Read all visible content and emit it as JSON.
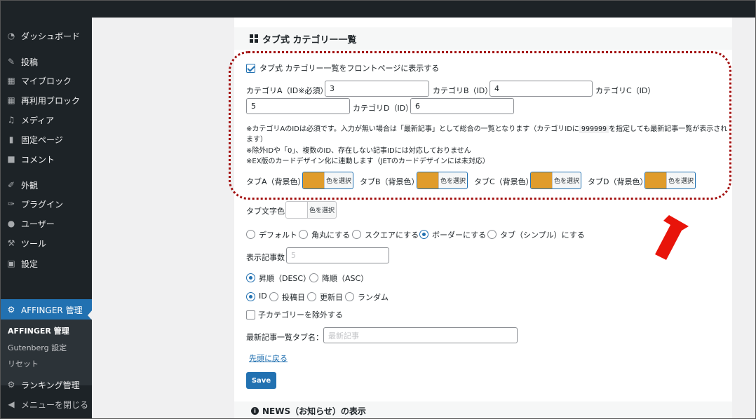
{
  "sidebar": {
    "items": [
      {
        "label": "ダッシュボード",
        "icon": "dashboard-icon"
      },
      {
        "label": "投稿",
        "icon": "pin-icon"
      },
      {
        "label": "マイブロック",
        "icon": "grid-icon"
      },
      {
        "label": "再利用ブロック",
        "icon": "grid-icon"
      },
      {
        "label": "メディア",
        "icon": "media-icon"
      },
      {
        "label": "固定ページ",
        "icon": "page-icon"
      },
      {
        "label": "コメント",
        "icon": "comment-icon"
      },
      {
        "label": "外観",
        "icon": "brush-icon"
      },
      {
        "label": "プラグイン",
        "icon": "plugin-icon"
      },
      {
        "label": "ユーザー",
        "icon": "user-icon"
      },
      {
        "label": "ツール",
        "icon": "wrench-icon"
      },
      {
        "label": "設定",
        "icon": "settings-icon"
      }
    ],
    "active_item": {
      "label": "AFFINGER 管理",
      "icon": "gear-icon"
    },
    "submenu": [
      {
        "label": "AFFINGER 管理",
        "current": true
      },
      {
        "label": "Gutenberg 設定",
        "current": false
      },
      {
        "label": "リセット",
        "current": false
      }
    ],
    "ranking": {
      "label": "ランキング管理",
      "icon": "gear-icon"
    },
    "collapse": {
      "label": "メニューを閉じる",
      "icon": "collapse-icon"
    }
  },
  "panel": {
    "title": "タブ式 カテゴリー一覧",
    "show_on_front": {
      "label": "タブ式 カテゴリー一覧をフロントページに表示する",
      "checked": true
    },
    "categories": {
      "a_label": "カテゴリA（ID※必須）",
      "a_value": "3",
      "b_label": "カテゴリB（ID）",
      "b_value": "4",
      "c_label": "カテゴリC（ID）",
      "c_value": "5",
      "d_label": "カテゴリD（ID）",
      "d_value": "6"
    },
    "notes": {
      "line1": "※カテゴリAのIDは必須です。入力が無い場合は「最新記事」として総合の一覧となります（カテゴリIDに",
      "code": "999999",
      "line1_end": "を指定しても最新記事一覧が表示され",
      "line2": "ます）",
      "line3": "※除外IDや「0」、複数のID、存在しない記事IDには対応しておりません",
      "line4": "※EX版のカードデザイン化に連動します（JETのカードデザインには未対応）"
    },
    "tab_colors": {
      "a_label": "タブA（背景色）",
      "b_label": "タブB（背景色）",
      "c_label": "タブC（背景色）",
      "d_label": "タブD（背景色）",
      "text_label": "タブ文字色",
      "select_label": "色を選択",
      "bg_color": "#e09c2b",
      "text_color": "#ffffff"
    },
    "style_options": {
      "default": "デフォルト",
      "rounded": "角丸にする",
      "square": "スクエアにする",
      "border": "ボーダーにする",
      "tab_simple": "タブ（シンプル）にする",
      "selected": "border"
    },
    "count": {
      "label": "表示記事数",
      "placeholder": "5"
    },
    "order": {
      "desc": "昇順（DESC）",
      "asc": "降順（ASC）",
      "selected": "desc"
    },
    "orderby": {
      "id": "ID",
      "post_date": "投稿日",
      "updated": "更新日",
      "random": "ランダム",
      "selected": "id"
    },
    "exclude_child": {
      "label": "子カテゴリーを除外する",
      "checked": false
    },
    "latest_tab": {
      "label": "最新記事一覧タブ名：",
      "placeholder": "最新記事"
    },
    "back_to_top": "先頭に戻る",
    "save": "Save"
  },
  "news_title": "NEWS（お知らせ）の表示",
  "colors": {
    "accent": "#2271b1",
    "sidebar": "#1d2327",
    "highlight": "#a31111",
    "arrow": "#e8140a"
  }
}
